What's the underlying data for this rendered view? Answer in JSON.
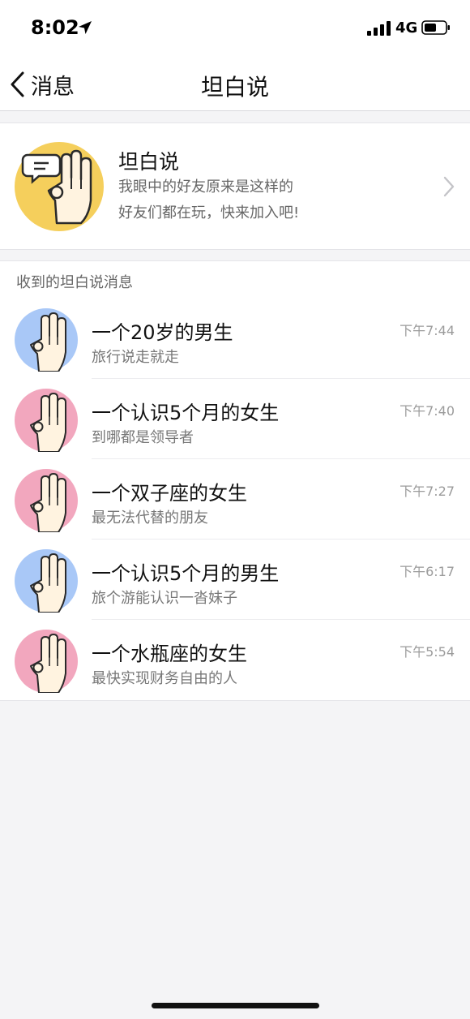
{
  "status_bar": {
    "time": "8:02",
    "network": "4G"
  },
  "nav": {
    "back_label": "消息",
    "title": "坦白说"
  },
  "banner": {
    "title": "坦白说",
    "line1": "我眼中的好友原来是这样的",
    "line2": "好友们都在玩，快来加入吧!"
  },
  "section": {
    "label": "收到的坦白说消息"
  },
  "messages": [
    {
      "title": "一个20岁的男生",
      "subtitle": "旅行说走就走",
      "time": "下午7:44",
      "avatar_color": "#a9c8f7"
    },
    {
      "title": "一个认识5个月的女生",
      "subtitle": "到哪都是领导者",
      "time": "下午7:40",
      "avatar_color": "#f2a7be"
    },
    {
      "title": "一个双子座的女生",
      "subtitle": "最无法代替的朋友",
      "time": "下午7:27",
      "avatar_color": "#f2a7be"
    },
    {
      "title": "一个认识5个月的男生",
      "subtitle": "旅个游能认识一沓妹子",
      "time": "下午6:17",
      "avatar_color": "#a9c8f7"
    },
    {
      "title": "一个水瓶座的女生",
      "subtitle": "最快实现财务自由的人",
      "time": "下午5:54",
      "avatar_color": "#f2a7be"
    }
  ],
  "colors": {
    "banner_avatar": "#f5cf5c",
    "male": "#a9c8f7",
    "female": "#f2a7be"
  },
  "icons": [
    "location-arrow-icon",
    "signal-icon",
    "battery-icon",
    "back-chevron-icon",
    "chevron-right-icon",
    "hand-gesture-icon",
    "speech-bubble-icon"
  ]
}
